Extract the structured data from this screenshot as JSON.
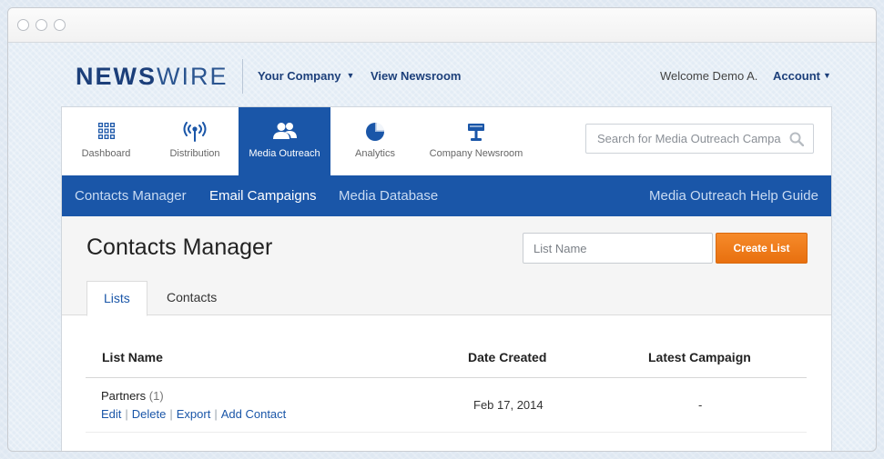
{
  "brand": {
    "logo_bold": "NEWS",
    "logo_light": "WIRE"
  },
  "topbar": {
    "company_menu": "Your Company",
    "view_newsroom": "View Newsroom",
    "welcome": "Welcome Demo A.",
    "account": "Account"
  },
  "nav": {
    "items": [
      {
        "label": "Dashboard",
        "icon": "grid-icon"
      },
      {
        "label": "Distribution",
        "icon": "broadcast-icon"
      },
      {
        "label": "Media Outreach",
        "icon": "people-icon",
        "active": true
      },
      {
        "label": "Analytics",
        "icon": "pie-chart-icon"
      },
      {
        "label": "Company Newsroom",
        "icon": "podium-icon"
      }
    ],
    "search_placeholder": "Search for Media Outreach Campa"
  },
  "subnav": {
    "contacts_manager": "Contacts Manager",
    "email_campaigns": "Email Campaigns",
    "media_database": "Media Database",
    "help_guide": "Media Outreach Help Guide"
  },
  "page": {
    "title": "Contacts Manager",
    "list_name_placeholder": "List Name",
    "create_list": "Create List",
    "tabs": [
      "Lists",
      "Contacts"
    ]
  },
  "table": {
    "headers": {
      "name": "List Name",
      "date": "Date Created",
      "campaign": "Latest Campaign"
    },
    "rows": [
      {
        "name": "Partners",
        "count": "(1)",
        "actions": {
          "edit": "Edit",
          "delete": "Delete",
          "export": "Export",
          "add_contact": "Add Contact"
        },
        "date": "Feb 17, 2014",
        "campaign": "-"
      }
    ]
  },
  "colors": {
    "brand_blue": "#1a56a8",
    "logo_navy": "#1c3f7a",
    "create_orange": "#f27f1c"
  }
}
